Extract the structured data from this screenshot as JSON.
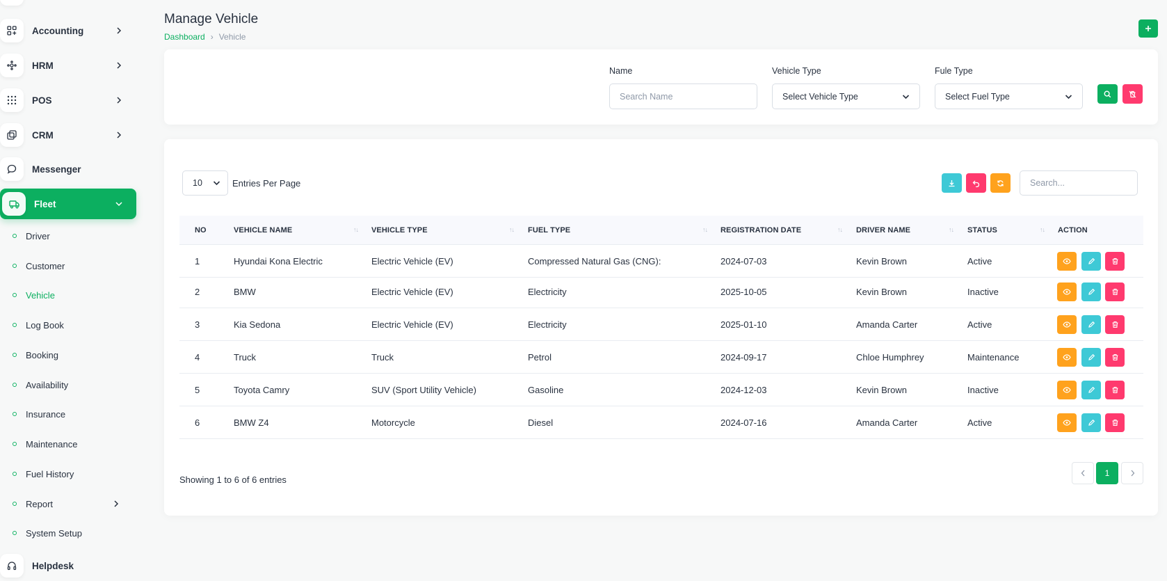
{
  "sidebar": {
    "main_items": [
      {
        "label": "Accounting",
        "icon": "apps-add-icon"
      },
      {
        "label": "HRM",
        "icon": "hrm-icon"
      },
      {
        "label": "POS",
        "icon": "grid-dots-icon"
      },
      {
        "label": "CRM",
        "icon": "layers-icon"
      },
      {
        "label": "Messenger",
        "icon": "messages-icon"
      },
      {
        "label": "Fleet",
        "icon": "car-icon"
      }
    ],
    "fleet_sub_items": [
      {
        "label": "Driver"
      },
      {
        "label": "Customer"
      },
      {
        "label": "Vehicle"
      },
      {
        "label": "Log Book"
      },
      {
        "label": "Booking"
      },
      {
        "label": "Availability"
      },
      {
        "label": "Insurance"
      },
      {
        "label": "Maintenance"
      },
      {
        "label": "Fuel History"
      },
      {
        "label": "Report"
      },
      {
        "label": "System Setup"
      }
    ],
    "helpdesk": {
      "label": "Helpdesk",
      "icon": "headset-icon"
    }
  },
  "header": {
    "title": "Manage Vehicle",
    "breadcrumb": {
      "home": "Dashboard",
      "current": "Vehicle"
    }
  },
  "filters": {
    "name_label": "Name",
    "name_placeholder": "Search Name",
    "vehicle_type_label": "Vehicle Type",
    "vehicle_type_value": "Select Vehicle Type",
    "fuel_type_label": "Fule Type",
    "fuel_type_value": "Select Fuel Type"
  },
  "table_controls": {
    "per_page_value": "10",
    "per_page_label": "Entries Per Page",
    "search_placeholder": "Search..."
  },
  "table": {
    "columns": [
      "NO",
      "VEHICLE NAME",
      "VEHICLE TYPE",
      "FUEL TYPE",
      "REGISTRATION DATE",
      "DRIVER NAME",
      "STATUS",
      "ACTION"
    ],
    "rows": [
      {
        "no": "1",
        "vehicle_name": "Hyundai Kona Electric",
        "vehicle_type": "Electric Vehicle (EV)",
        "fuel_type": "Compressed Natural Gas (CNG):",
        "registration_date": "2024-07-03",
        "driver_name": "Kevin Brown",
        "status": "Active"
      },
      {
        "no": "2",
        "vehicle_name": "BMW",
        "vehicle_type": "Electric Vehicle (EV)",
        "fuel_type": "Electricity",
        "registration_date": "2025-10-05",
        "driver_name": "Kevin Brown",
        "status": "Inactive"
      },
      {
        "no": "3",
        "vehicle_name": "Kia Sedona",
        "vehicle_type": "Electric Vehicle (EV)",
        "fuel_type": "Electricity",
        "registration_date": "2025-01-10",
        "driver_name": "Amanda Carter",
        "status": "Active"
      },
      {
        "no": "4",
        "vehicle_name": "Truck",
        "vehicle_type": "Truck",
        "fuel_type": "Petrol",
        "registration_date": "2024-09-17",
        "driver_name": "Chloe Humphrey",
        "status": "Maintenance"
      },
      {
        "no": "5",
        "vehicle_name": "Toyota Camry",
        "vehicle_type": "SUV (Sport Utility Vehicle)",
        "fuel_type": "Gasoline",
        "registration_date": "2024-12-03",
        "driver_name": "Kevin Brown",
        "status": "Inactive"
      },
      {
        "no": "6",
        "vehicle_name": "BMW Z4",
        "vehicle_type": "Motorcycle",
        "fuel_type": "Diesel",
        "registration_date": "2024-07-16",
        "driver_name": "Amanda Carter",
        "status": "Active"
      }
    ]
  },
  "pagination": {
    "showing_text": "Showing 1 to 6 of 6 entries",
    "current_page": "1",
    "prev_icon": "chevron-left-icon",
    "next_icon": "chevron-right-icon"
  },
  "colors": {
    "primary": "#0caf60",
    "danger": "#ff3a6e",
    "info": "#3ec9d6",
    "warning": "#ffa21d",
    "text": "#293240",
    "muted": "#8f99a8"
  }
}
